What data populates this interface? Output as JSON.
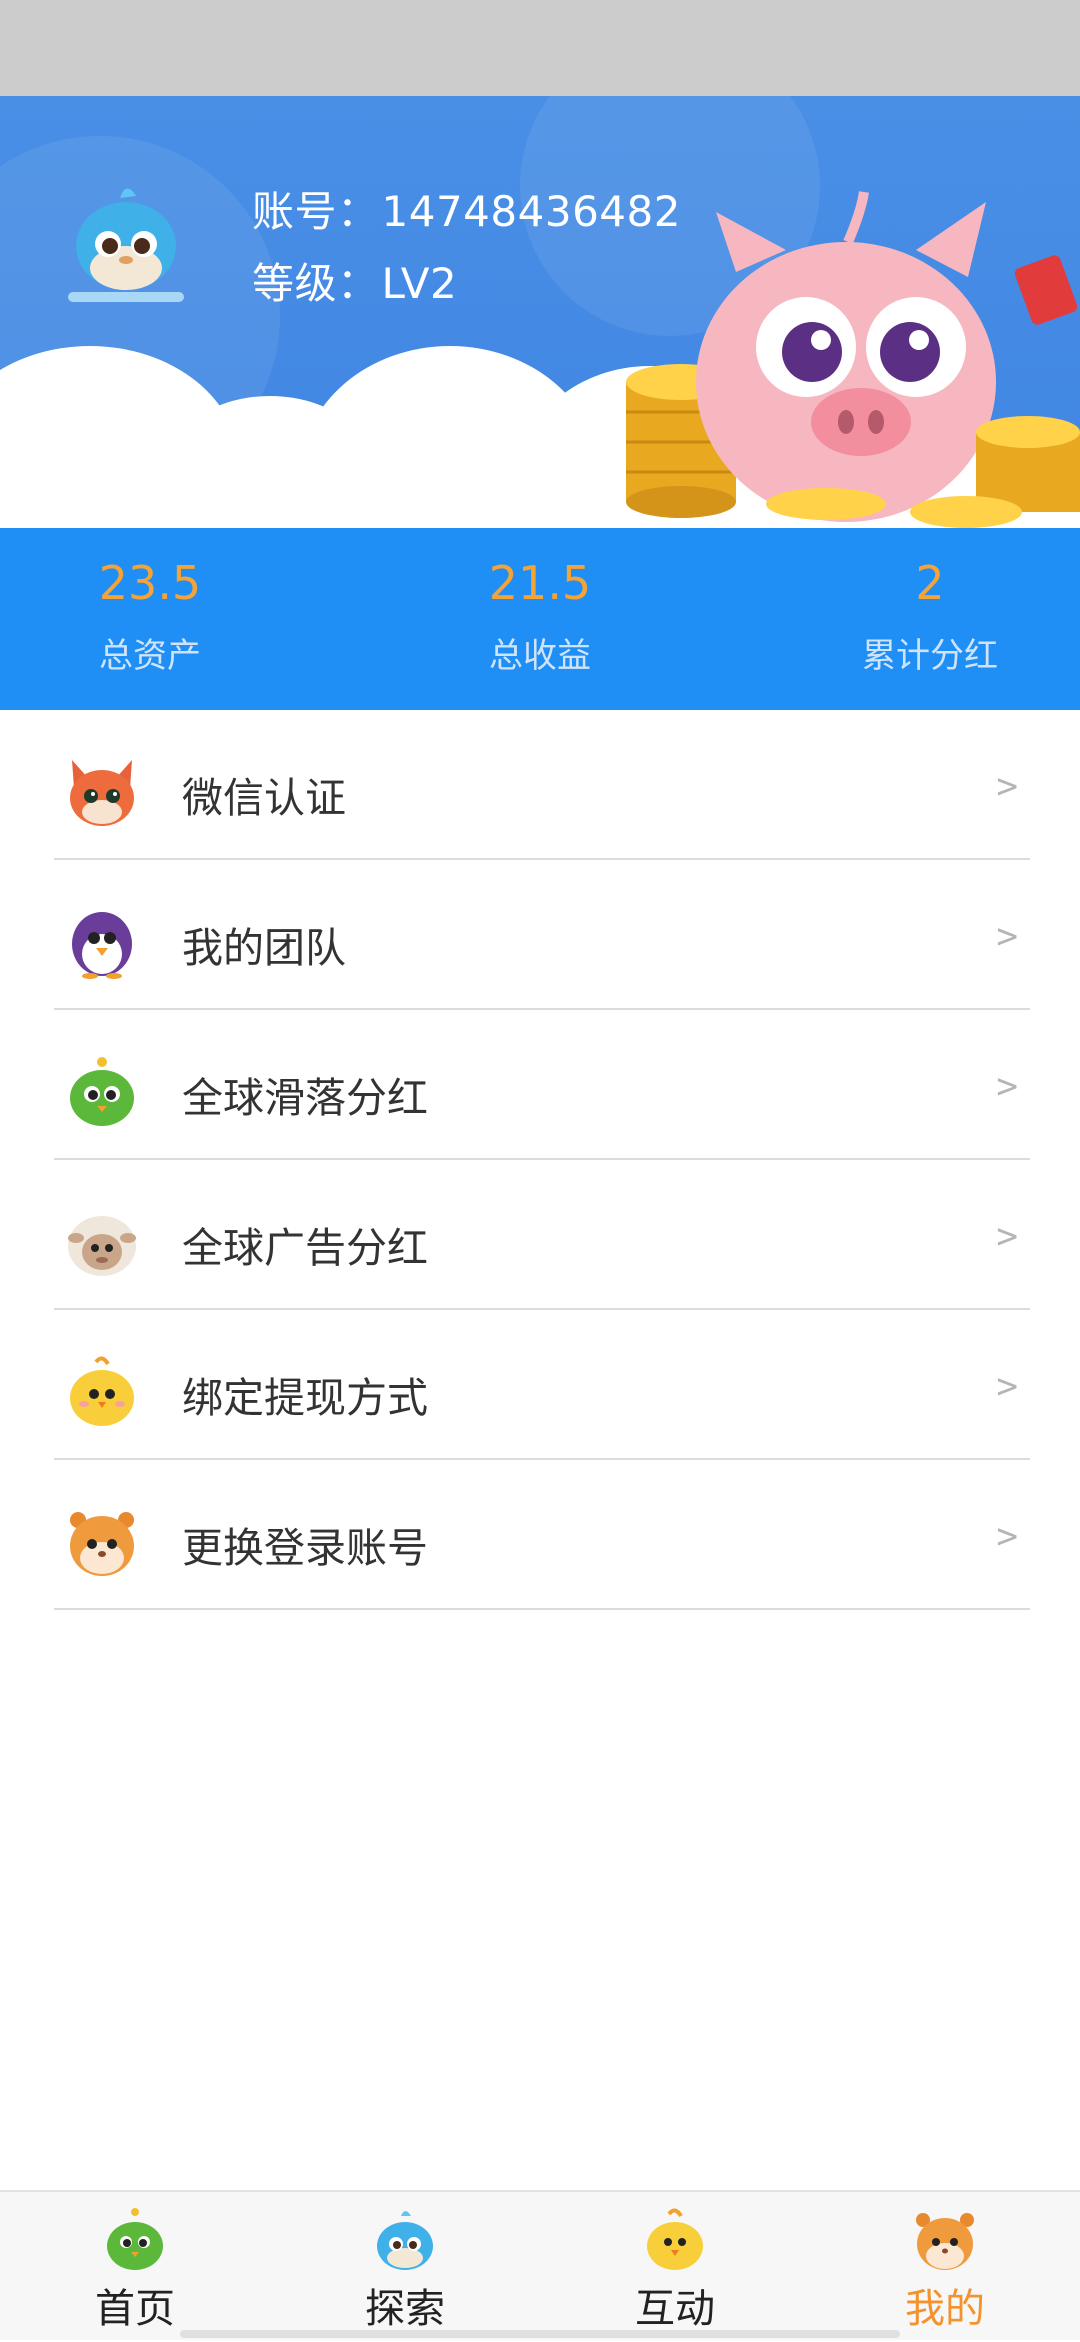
{
  "header": {
    "account_label": "账号：",
    "account_value": "14748436482",
    "level_label": "等级：",
    "level_value": "LV2"
  },
  "stats": [
    {
      "value": "23.5",
      "label": "总资产"
    },
    {
      "value": "21.5",
      "label": "总收益"
    },
    {
      "value": "2",
      "label": "累计分红"
    }
  ],
  "menu": [
    {
      "label": "微信认证",
      "icon": "fox-icon",
      "arrow": ">"
    },
    {
      "label": "我的团队",
      "icon": "penguin-icon",
      "arrow": ">"
    },
    {
      "label": "全球滑落分红",
      "icon": "green-bird-icon",
      "arrow": ">"
    },
    {
      "label": "全球广告分红",
      "icon": "sheep-icon",
      "arrow": ">"
    },
    {
      "label": "绑定提现方式",
      "icon": "chick-icon",
      "arrow": ">"
    },
    {
      "label": "更换登录账号",
      "icon": "hamster-icon",
      "arrow": ">"
    }
  ],
  "tabs": [
    {
      "label": "首页",
      "icon": "green-bird-icon",
      "active": false
    },
    {
      "label": "探索",
      "icon": "blue-bird-icon",
      "active": false
    },
    {
      "label": "互动",
      "icon": "chick-icon",
      "active": false
    },
    {
      "label": "我的",
      "icon": "hamster-icon",
      "active": true
    }
  ],
  "colors": {
    "header_blue": "#4a8fe6",
    "stats_blue": "#1f8ef5",
    "accent_orange": "#f4a336",
    "active_tab": "#f4932e"
  }
}
